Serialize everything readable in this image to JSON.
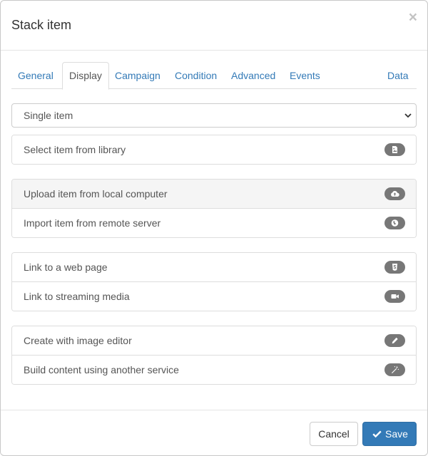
{
  "modal": {
    "title": "Stack item",
    "close_label": "×"
  },
  "tabs": [
    {
      "label": "General",
      "active": false
    },
    {
      "label": "Display",
      "active": true
    },
    {
      "label": "Campaign",
      "active": false
    },
    {
      "label": "Condition",
      "active": false
    },
    {
      "label": "Advanced",
      "active": false
    },
    {
      "label": "Events",
      "active": false
    },
    {
      "label": "Data",
      "active": false
    }
  ],
  "select": {
    "value": "Single item"
  },
  "groups": [
    [
      {
        "label": "Select item from library",
        "icon": "file-image-icon"
      }
    ],
    [
      {
        "label": "Upload item from local computer",
        "icon": "cloud-upload-icon"
      },
      {
        "label": "Import item from remote server",
        "icon": "globe-icon"
      }
    ],
    [
      {
        "label": "Link to a web page",
        "icon": "html5-icon"
      },
      {
        "label": "Link to streaming media",
        "icon": "video-camera-icon"
      }
    ],
    [
      {
        "label": "Create with image editor",
        "icon": "pencil-icon"
      },
      {
        "label": "Build content using another service",
        "icon": "magic-wand-icon"
      }
    ]
  ],
  "footer": {
    "cancel_label": "Cancel",
    "save_label": "Save"
  },
  "colors": {
    "link": "#337ab7",
    "primary": "#337ab7",
    "badge": "#777777",
    "hover_row": "#f5f5f5"
  }
}
